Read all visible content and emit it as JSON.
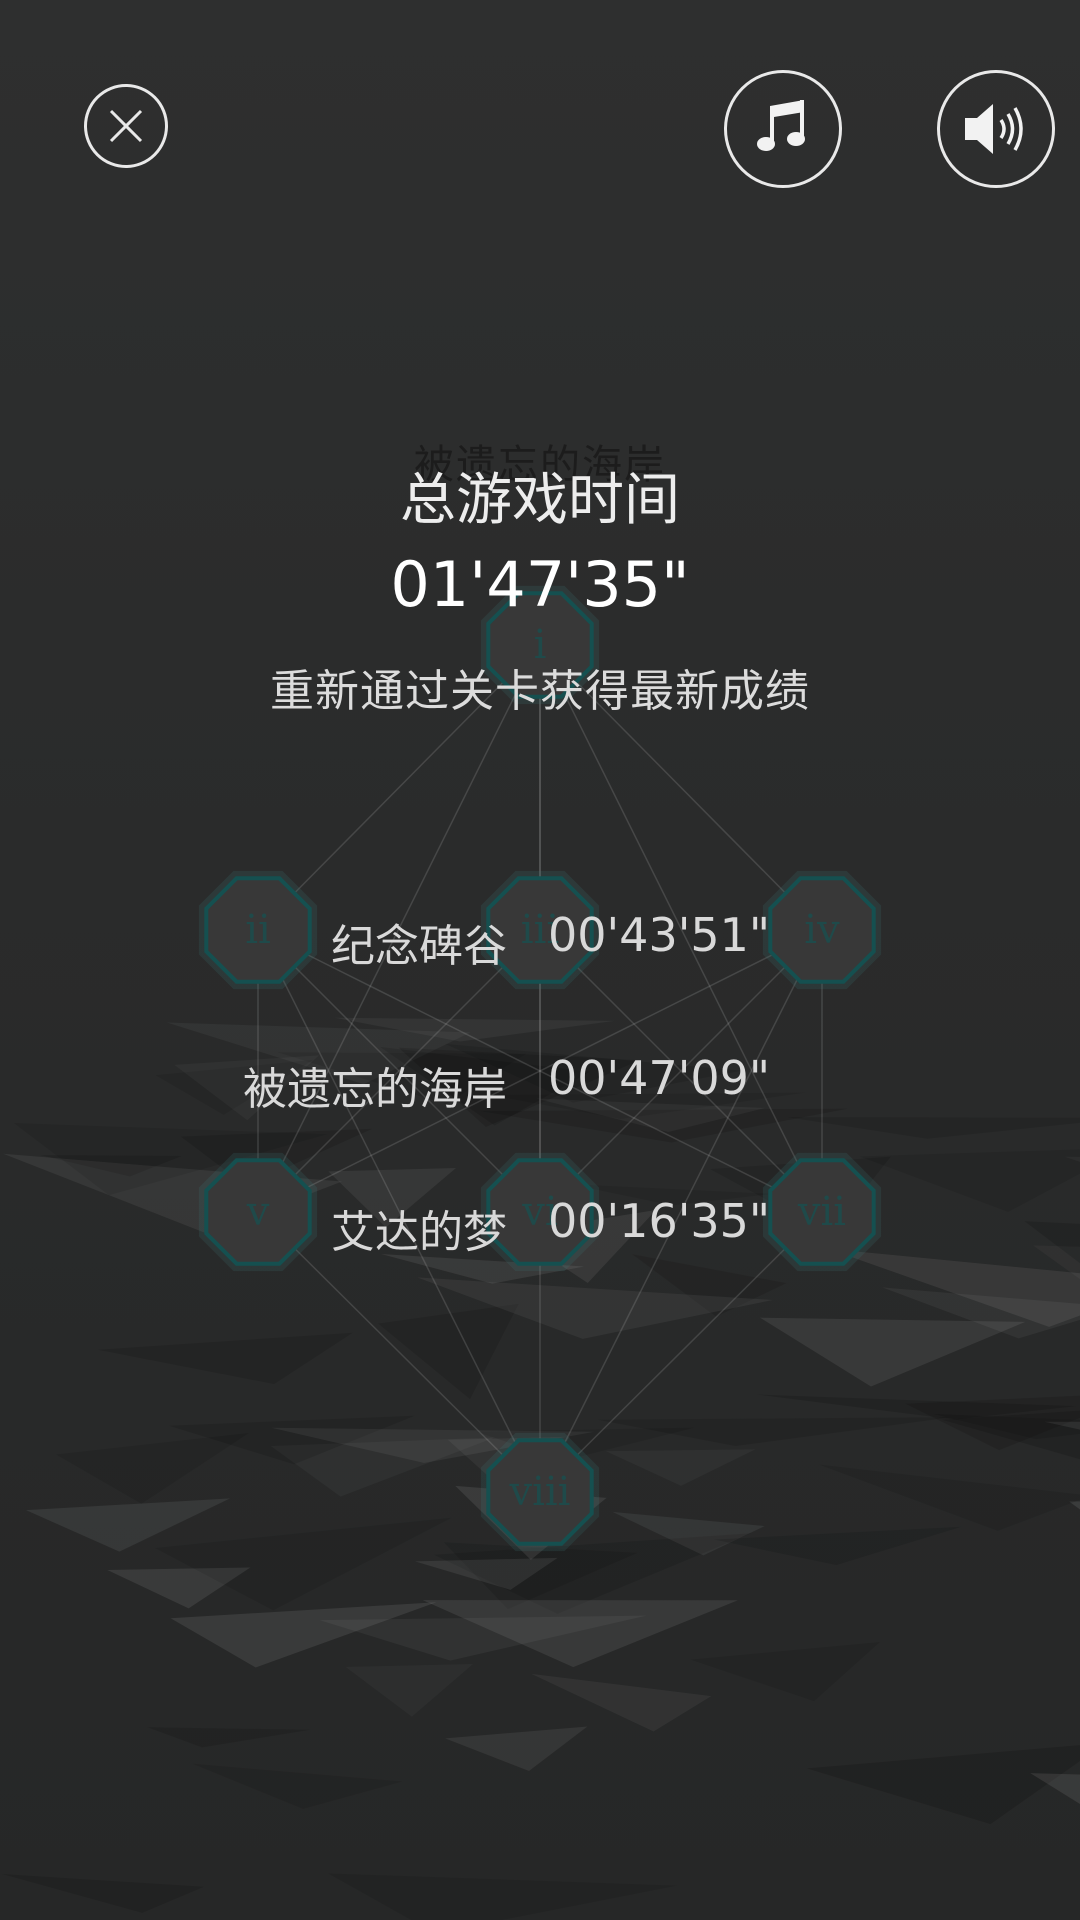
{
  "header": {
    "close_icon": "close-icon",
    "music_icon": "music-note-icon",
    "sound_icon": "speaker-volume-icon"
  },
  "level_map": {
    "nodes": [
      "i",
      "ii",
      "iii",
      "iv",
      "v",
      "vi",
      "vii",
      "viii"
    ],
    "node_color": "#1f4a4a",
    "node_fill": "#383838",
    "node_glow": "#3d7a78"
  },
  "faint_title": "被遗忘的海岸",
  "summary": {
    "total_label": "总游戏时间",
    "total_time": "01'47'35\"",
    "hint": "重新通过关卡获得最新成绩"
  },
  "records": [
    {
      "name": "纪念碑谷",
      "time": "00'43'51\""
    },
    {
      "name": "被遗忘的海岸",
      "time": "00'47'09\""
    },
    {
      "name": "艾达的梦",
      "time": "00'16'35\""
    }
  ]
}
